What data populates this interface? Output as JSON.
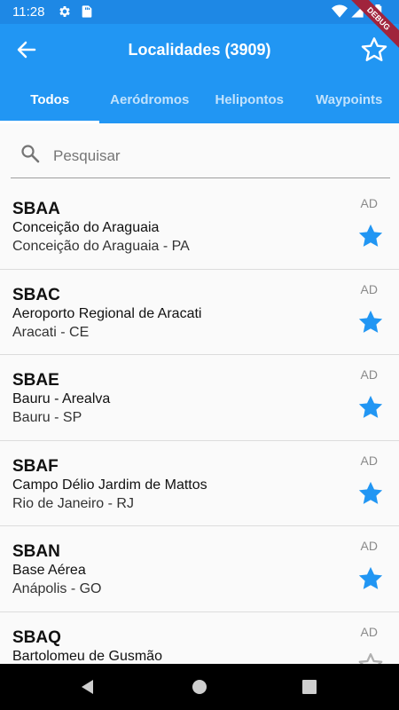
{
  "status_bar": {
    "time": "11:28"
  },
  "app_bar": {
    "title": "Localidades (3909)"
  },
  "debug_label": "DEBUG",
  "tabs": [
    {
      "label": "Todos",
      "active": true
    },
    {
      "label": "Aeródromos",
      "active": false
    },
    {
      "label": "Helipontos",
      "active": false
    },
    {
      "label": "Waypoints",
      "active": false
    }
  ],
  "search": {
    "placeholder": "Pesquisar",
    "value": ""
  },
  "items": [
    {
      "code": "SBAA",
      "name": "Conceição do Araguaia",
      "city": "Conceição do Araguaia - PA",
      "type": "AD",
      "favorite": true
    },
    {
      "code": "SBAC",
      "name": "Aeroporto Regional de Aracati",
      "city": "Aracati - CE",
      "type": "AD",
      "favorite": true
    },
    {
      "code": "SBAE",
      "name": "Bauru - Arealva",
      "city": "Bauru - SP",
      "type": "AD",
      "favorite": true
    },
    {
      "code": "SBAF",
      "name": "Campo Délio Jardim de Mattos",
      "city": "Rio de Janeiro - RJ",
      "type": "AD",
      "favorite": true
    },
    {
      "code": "SBAN",
      "name": "Base Aérea",
      "city": "Anápolis - GO",
      "type": "AD",
      "favorite": true
    },
    {
      "code": "SBAQ",
      "name": "Bartolomeu de Gusmão",
      "city": "",
      "type": "AD",
      "favorite": false
    }
  ],
  "colors": {
    "primary": "#2196f3",
    "status_bar": "#1e88e5",
    "favorite_star": "#2196f3",
    "empty_star": "#b0b0b0"
  }
}
